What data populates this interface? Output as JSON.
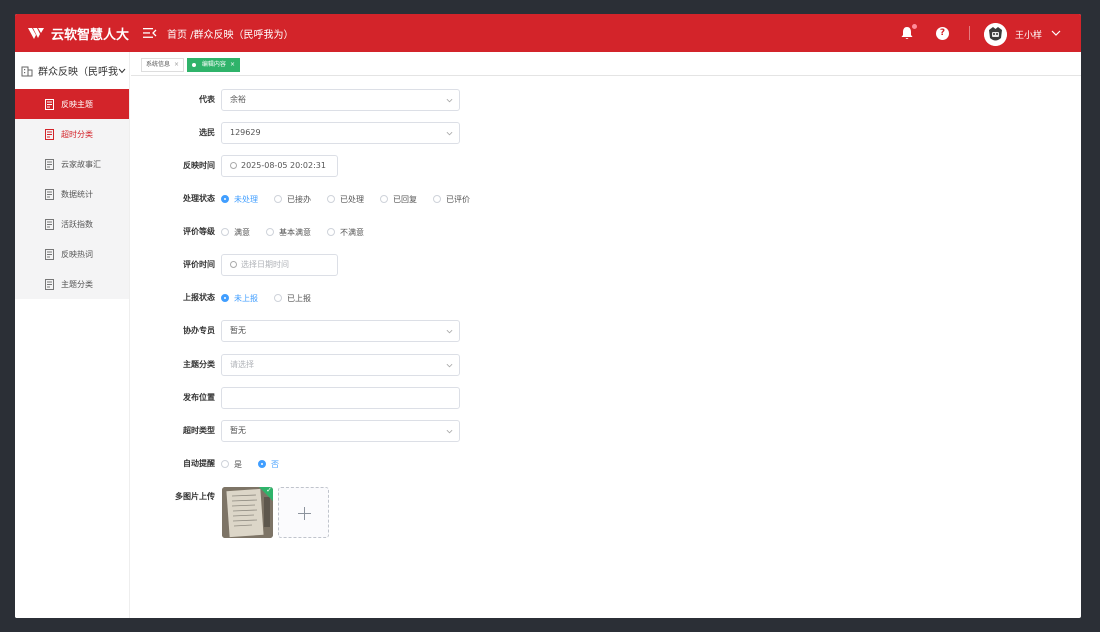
{
  "header": {
    "app_title": "云软智慧人大",
    "breadcrumb": "首页 /群众反映（民呼我为）",
    "notification_count": "1",
    "help_label": "?",
    "user_name": "王小样"
  },
  "sidebar": {
    "group_label": "群众反映（民呼我",
    "items": [
      {
        "label": "反映主题"
      },
      {
        "label": "超时分类"
      },
      {
        "label": "云家故事汇"
      },
      {
        "label": "数据统计"
      },
      {
        "label": "活跃指数"
      },
      {
        "label": "反映热词"
      },
      {
        "label": "主题分类"
      }
    ]
  },
  "tabs": [
    {
      "label": "系统信息",
      "close": "×"
    },
    {
      "label": "编辑内容",
      "close": "×"
    }
  ],
  "form": {
    "representative": {
      "label": "代表",
      "value": "余裕"
    },
    "voter": {
      "label": "选民",
      "value": "129629"
    },
    "report_time": {
      "label": "反映时间",
      "value": "2025-08-05 20:02:31"
    },
    "process_status": {
      "label": "处理状态",
      "options": [
        "未处理",
        "已接办",
        "已处理",
        "已回复",
        "已评价"
      ],
      "selected": "未处理"
    },
    "rating_level": {
      "label": "评价等级",
      "options": [
        "满意",
        "基本满意",
        "不满意"
      ]
    },
    "rating_time": {
      "label": "评价时间",
      "placeholder": "选择日期时间"
    },
    "report_status": {
      "label": "上报状态",
      "options": [
        "未上报",
        "已上报"
      ],
      "selected": "未上报"
    },
    "assist_member": {
      "label": "协办专员",
      "value": "暂无"
    },
    "topic_category": {
      "label": "主题分类",
      "placeholder": "请选择"
    },
    "publish_location": {
      "label": "发布位置",
      "value": ""
    },
    "timeout_type": {
      "label": "超时类型",
      "value": "暂无"
    },
    "auto_remind": {
      "label": "自动提醒",
      "options": [
        "是",
        "否"
      ],
      "selected": "否"
    },
    "images": {
      "label": "多图片上传"
    }
  },
  "colors": {
    "brand": "#d3242a",
    "radio_active": "#409eff",
    "tag_active": "#2fb36a"
  }
}
